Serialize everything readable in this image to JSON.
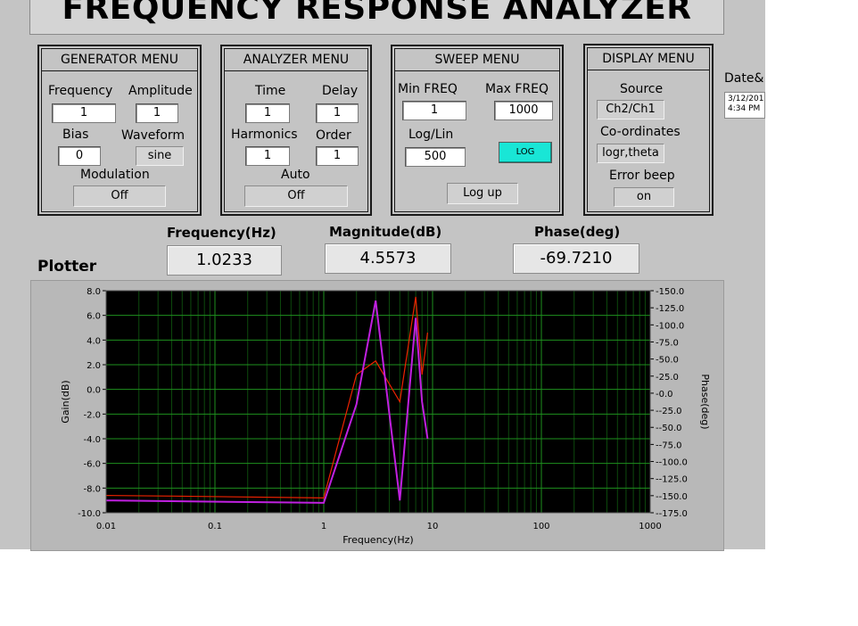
{
  "title": "FREQUENCY RESPONSE ANALYZER",
  "generator": {
    "header": "GENERATOR MENU",
    "frequency_label": "Frequency",
    "frequency_value": "1",
    "amplitude_label": "Amplitude",
    "amplitude_value": "1",
    "bias_label": "Bias",
    "bias_value": "0",
    "waveform_label": "Waveform",
    "waveform_value": "sine",
    "modulation_label": "Modulation",
    "modulation_value": "Off"
  },
  "analyzer": {
    "header": "ANALYZER MENU",
    "time_label": "Time",
    "time_value": "1",
    "delay_label": "Delay",
    "delay_value": "1",
    "harmonics_label": "Harmonics",
    "harmonics_value": "1",
    "order_label": "Order",
    "order_value": "1",
    "auto_label": "Auto",
    "auto_value": "Off"
  },
  "sweep": {
    "header": "SWEEP MENU",
    "min_label": "Min FREQ",
    "min_value": "1",
    "max_label": "Max FREQ",
    "max_value": "1000",
    "loglin_label": "Log/Lin",
    "loglin_value": "500",
    "log_button": "LOG",
    "log_up": "Log up"
  },
  "display": {
    "header": "DISPLAY MENU",
    "source_label": "Source",
    "source_value": "Ch2/Ch1",
    "coords_label": "Co-ordinates",
    "coords_value": "logr,theta",
    "beep_label": "Error beep",
    "beep_value": "on"
  },
  "date": {
    "label": "Date&",
    "line1": "3/12/201",
    "line2": "4:34 PM"
  },
  "readouts": {
    "freq_label": "Frequency(Hz)",
    "freq_value": "1.0233",
    "mag_label": "Magnitude(dB)",
    "mag_value": "4.5573",
    "phase_label": "Phase(deg)",
    "phase_value": "-69.7210"
  },
  "plotter_label": "Plotter",
  "colors": {
    "plot_bg": "#000000",
    "grid_major": "#1e8f1e",
    "grid_minor": "#0d4a0d",
    "gain": "#ee2200",
    "phase": "#c020e0",
    "log_button": "#19e6d6"
  },
  "chart_data": {
    "type": "line",
    "xlabel": "Frequency(Hz)",
    "ylabel": "Gain(dB)",
    "y2label": "Phase(deg)",
    "xscale": "log",
    "xlim": [
      0.01,
      1000
    ],
    "ylim": [
      -10,
      8
    ],
    "y2lim": [
      -175,
      150
    ],
    "x_ticks": [
      "0.01",
      "0.1",
      "1",
      "10",
      "100",
      "1000"
    ],
    "y_ticks": [
      "8.0",
      "6.0",
      "4.0",
      "2.0",
      "0.0",
      "-2.0",
      "-4.0",
      "-6.0",
      "-8.0",
      "-10.0"
    ],
    "y2_ticks": [
      "150.0",
      "125.0",
      "100.0",
      "75.0",
      "50.0",
      "25.0",
      "0.0",
      "-25.0",
      "-50.0",
      "-75.0",
      "-100.0",
      "-125.0",
      "-150.0",
      "-175.0"
    ],
    "grid": true,
    "series": [
      {
        "axis": "left",
        "color": "#ee2200",
        "x": [
          0.01,
          0.04,
          1,
          2,
          3,
          5,
          7,
          8,
          9
        ],
        "y": [
          -8.6,
          -8.65,
          -8.8,
          1.2,
          2.3,
          -1.0,
          7.5,
          1.2,
          4.6
        ]
      },
      {
        "axis": "left",
        "color": "#c020e0",
        "x": [
          0.01,
          1,
          2,
          3,
          5,
          7,
          8,
          9
        ],
        "y": [
          -9.0,
          -9.2,
          -1.2,
          7.2,
          -9.0,
          5.8,
          -1.0,
          -4.0
        ]
      }
    ]
  }
}
